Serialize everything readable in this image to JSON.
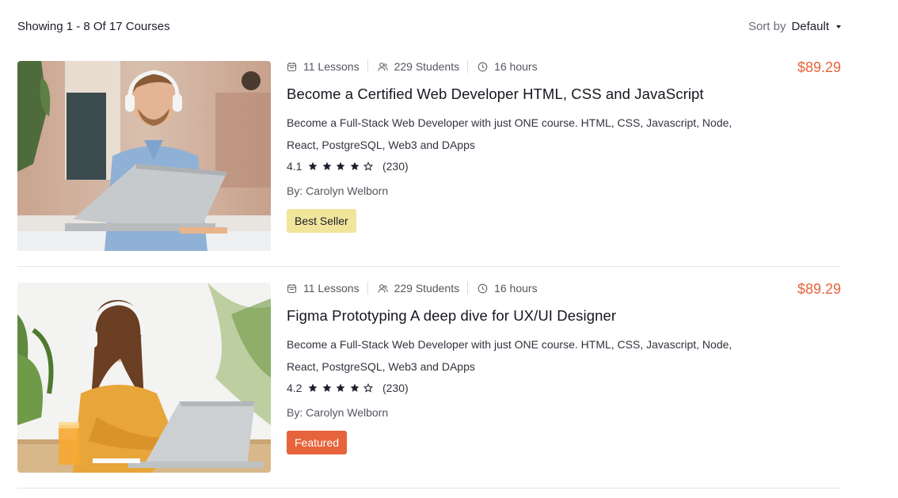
{
  "toolbar": {
    "result_text": "Showing 1 - 8 Of 17 Courses",
    "sort_label": "Sort by",
    "sort_value": "Default"
  },
  "colors": {
    "price": "#e7633c",
    "badge_best_seller": "#f0e59a",
    "badge_featured": "#e7633c"
  },
  "courses": [
    {
      "lessons": "11 Lessons",
      "students": "229 Students",
      "duration": "16 hours",
      "price": "$89.29",
      "title": "Become a Certified Web Developer HTML, CSS and JavaScript",
      "description": "Become a Full-Stack Web Developer with just ONE course. HTML, CSS, Javascript, Node, React, PostgreSQL, Web3 and DApps",
      "rating": "4.1",
      "rating_count": "(230)",
      "stars_filled": 4,
      "author": "By: Carolyn Welborn",
      "badge": "Best Seller",
      "icons": [
        "lessons-icon",
        "students-icon",
        "clock-icon"
      ]
    },
    {
      "lessons": "11 Lessons",
      "students": "229 Students",
      "duration": "16 hours",
      "price": "$89.29",
      "title": "Figma Prototyping A deep dive for UX/UI Designer",
      "description": "Become a Full-Stack Web Developer with just ONE course. HTML, CSS, Javascript, Node, React, PostgreSQL, Web3 and DApps",
      "rating": "4.2",
      "rating_count": "(230)",
      "stars_filled": 4,
      "author": "By: Carolyn Welborn",
      "badge": "Featured",
      "icons": [
        "lessons-icon",
        "students-icon",
        "clock-icon"
      ]
    }
  ]
}
